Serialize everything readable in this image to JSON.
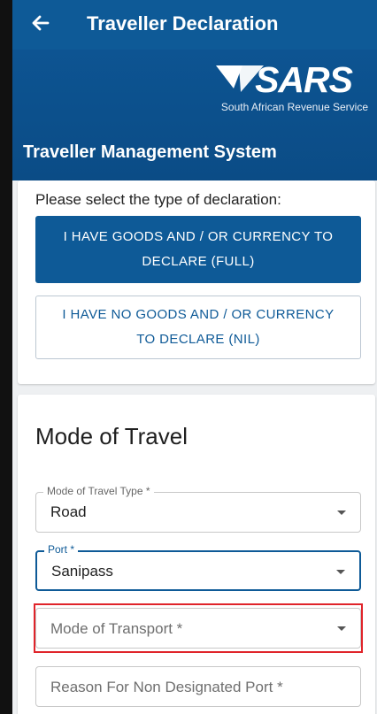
{
  "appbar": {
    "title": "Traveller Declaration"
  },
  "header": {
    "logo_text": "SARS",
    "revenue_service": "South African Revenue Service",
    "system_title": "Traveller Management System"
  },
  "declaration": {
    "prompt": "Please select the type of declaration:",
    "full_button_label": "I HAVE GOODS AND / OR CURRENCY TO DECLARE (FULL)",
    "nil_button_label": "I HAVE NO GOODS AND / OR CURRENCY TO DECLARE (NIL)"
  },
  "travel": {
    "section_title": "Mode of Travel",
    "mode_of_travel_type": {
      "label": "Mode of Travel Type *",
      "value": "Road"
    },
    "port": {
      "label": "Port *",
      "value": "Sanipass"
    },
    "mode_of_transport": {
      "placeholder": "Mode of Transport *"
    },
    "reason_non_designated_port": {
      "placeholder": "Reason For Non Designated Port *"
    }
  },
  "colors": {
    "brand": "#0e5a97",
    "highlight": "#e0242a"
  }
}
